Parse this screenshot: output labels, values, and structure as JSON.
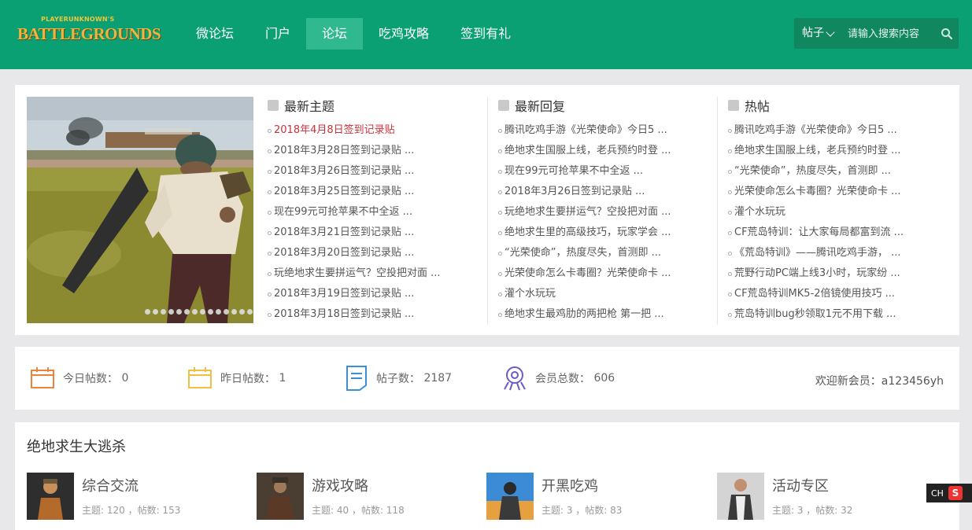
{
  "brand": {
    "small": "PLAYERUNKNOWN'S",
    "big": "BATTLEGROUNDS"
  },
  "nav": [
    {
      "label": "微论坛"
    },
    {
      "label": "门户"
    },
    {
      "label": "论坛",
      "active": true
    },
    {
      "label": "吃鸡攻略"
    },
    {
      "label": "签到有礼"
    }
  ],
  "search": {
    "type": "帖子",
    "placeholder": "请输入搜索内容"
  },
  "columns": {
    "latest_topics": {
      "title": "最新主题",
      "items": [
        "2018年4月8日签到记录贴",
        "2018年3月28日签到记录贴 ...",
        "2018年3月26日签到记录贴 ...",
        "2018年3月25日签到记录贴 ...",
        "现在99元可抢苹果不中全返 ...",
        "2018年3月21日签到记录贴 ...",
        "2018年3月20日签到记录贴 ...",
        "玩绝地求生要拼运气？空投把对面 ...",
        "2018年3月19日签到记录贴 ...",
        "2018年3月18日签到记录贴 ..."
      ]
    },
    "latest_replies": {
      "title": "最新回复",
      "items": [
        "腾讯吃鸡手游《光荣使命》今日5 ...",
        "绝地求生国服上线，老兵预约时登 ...",
        "现在99元可抢苹果不中全返 ...",
        "2018年3月26日签到记录贴 ...",
        "玩绝地求生要拼运气？空投把对面 ...",
        "绝地求生里的高级技巧，玩家学会 ...",
        "“光荣使命”，热度尽失，首测即 ...",
        "光荣使命怎么卡毒圈？光荣使命卡 ...",
        "灌个水玩玩",
        "绝地求生最鸡肋的两把枪 第一把 ..."
      ]
    },
    "hot": {
      "title": "热帖",
      "items": [
        "腾讯吃鸡手游《光荣使命》今日5 ...",
        "绝地求生国服上线，老兵预约时登 ...",
        "“光荣使命”，热度尽失，首测即 ...",
        "光荣使命怎么卡毒圈？光荣使命卡 ...",
        "灌个水玩玩",
        "CF荒岛特训：让大家每局都富到流 ...",
        "《荒岛特训》——腾讯吃鸡手游， ...",
        "荒野行动PC端上线3小时，玩家纷 ...",
        "CF荒岛特训MK5-2倍镜使用技巧 ...",
        "荒岛特训bug秒领取1元不用下载 ..."
      ]
    }
  },
  "stats": {
    "today": {
      "label": "今日帖数：",
      "value": "0"
    },
    "yesterday": {
      "label": "昨日帖数：",
      "value": "1"
    },
    "posts": {
      "label": "帖子数：",
      "value": "2187"
    },
    "members": {
      "label": "会员总数：",
      "value": "606"
    },
    "welcome": "欢迎新会员：a123456yh"
  },
  "section_title": "绝地求生大逃杀",
  "forums": [
    {
      "name": "综合交流",
      "meta": "主题: 120 ，帖数: 153"
    },
    {
      "name": "游戏攻略",
      "meta": "主题: 40 ，帖数: 118"
    },
    {
      "name": "开黑吃鸡",
      "meta": "主题: 3 ，帖数: 83"
    },
    {
      "name": "活动专区",
      "meta": "主题: 3 ，帖数: 32"
    }
  ],
  "ime": {
    "label": "CH",
    "badge": "S"
  },
  "colors": {
    "header": "#0aa073",
    "nav_active": "#30b98f",
    "accent_red": "#c8323a"
  }
}
